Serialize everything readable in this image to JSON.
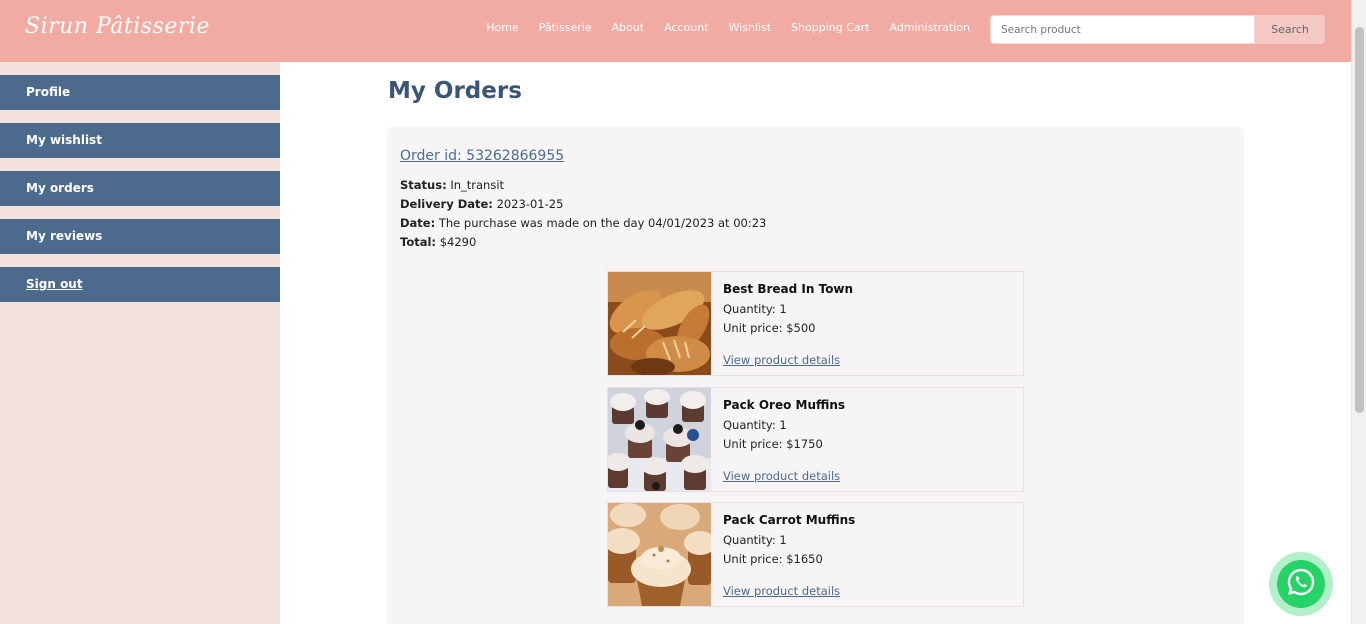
{
  "header": {
    "brand": "Sirun Pâtisserie",
    "nav": [
      "Home",
      "Pâtisserie",
      "About",
      "Account",
      "Wishlist",
      "Shopping Cart",
      "Administration"
    ],
    "search_placeholder": "Search product",
    "search_button": "Search"
  },
  "sidebar": {
    "items": [
      "Profile",
      "My wishlist",
      "My orders",
      "My reviews",
      "Sign out"
    ]
  },
  "main": {
    "title": "My Orders",
    "order": {
      "id_label": "Order id: 53262866955",
      "status_label": "Status:",
      "status_value": "In_transit",
      "delivery_label": "Delivery Date:",
      "delivery_value": "2023-01-25",
      "date_label": "Date:",
      "date_value": "The purchase was made on the day 04/01/2023 at 00:23",
      "total_label": "Total:",
      "total_value": "$4290",
      "products": [
        {
          "name": "Best Bread In Town",
          "quantity": "Quantity: 1",
          "unit_price": "Unit price: $500",
          "link": "View product details",
          "image": "bread-photo"
        },
        {
          "name": "Pack Oreo Muffins",
          "quantity": "Quantity: 1",
          "unit_price": "Unit price: $1750",
          "link": "View product details",
          "image": "oreo-muffins-photo"
        },
        {
          "name": "Pack Carrot Muffins",
          "quantity": "Quantity: 1",
          "unit_price": "Unit price: $1650",
          "link": "View product details",
          "image": "carrot-muffins-photo"
        }
      ]
    }
  },
  "widgets": {
    "whatsapp_icon": "whatsapp-icon"
  },
  "colors": {
    "header_bg": "#f2aba3",
    "sidebar_bg": "#f3e1de",
    "sidebar_item_bg": "#4c6b8c",
    "title": "#3a5674",
    "link": "#4a6b8e",
    "whatsapp": "#25d366"
  }
}
